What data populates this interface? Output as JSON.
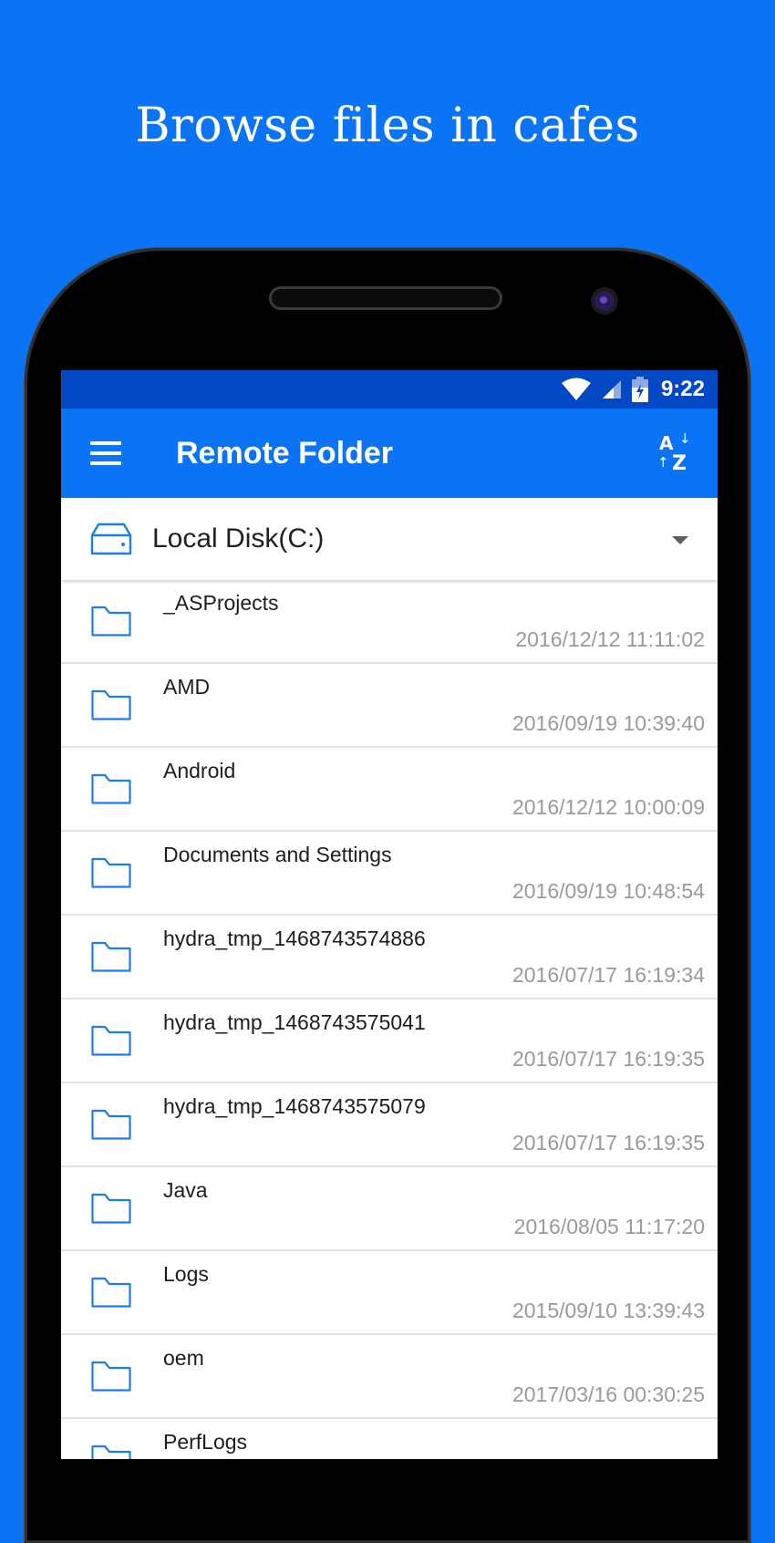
{
  "headline": "Browse files in cafes",
  "status_bar": {
    "time": "9:22"
  },
  "app_bar": {
    "title": "Remote Folder"
  },
  "drive_selector": {
    "selected": "Local Disk(C:)"
  },
  "files": [
    {
      "name": "_ASProjects",
      "modified": "2016/12/12 11:11:02"
    },
    {
      "name": "AMD",
      "modified": "2016/09/19 10:39:40"
    },
    {
      "name": "Android",
      "modified": "2016/12/12 10:00:09"
    },
    {
      "name": "Documents and Settings",
      "modified": "2016/09/19 10:48:54"
    },
    {
      "name": "hydra_tmp_1468743574886",
      "modified": "2016/07/17 16:19:34"
    },
    {
      "name": "hydra_tmp_1468743575041",
      "modified": "2016/07/17 16:19:35"
    },
    {
      "name": "hydra_tmp_1468743575079",
      "modified": "2016/07/17 16:19:35"
    },
    {
      "name": "Java",
      "modified": "2016/08/05 11:17:20"
    },
    {
      "name": "Logs",
      "modified": "2015/09/10 13:39:43"
    },
    {
      "name": "oem",
      "modified": "2017/03/16 00:30:25"
    },
    {
      "name": "PerfLogs",
      "modified": ""
    }
  ],
  "colors": {
    "background": "#0a74f5",
    "status_bar": "#0348c4",
    "app_bar": "#0a74f5",
    "accent": "#1e7de6"
  }
}
